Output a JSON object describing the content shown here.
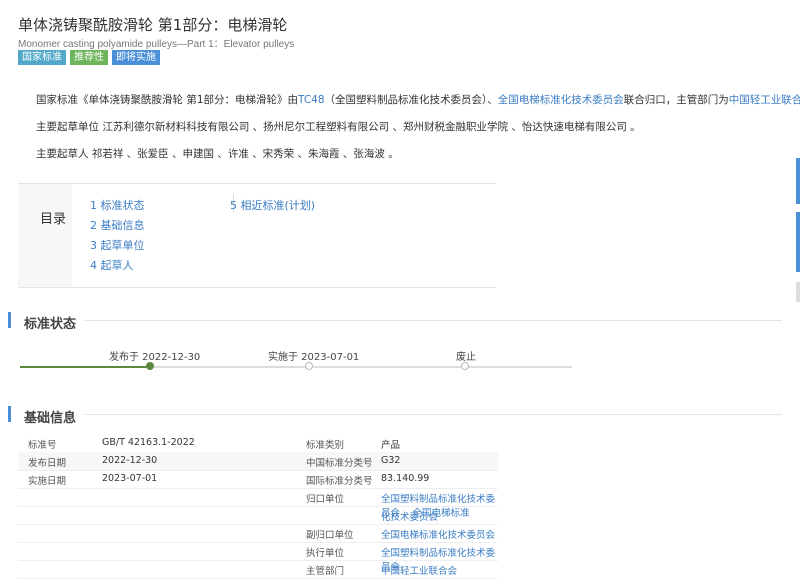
{
  "header": {
    "title": "单体浇铸聚酰胺滑轮 第1部分：电梯滑轮",
    "subtitle": "Monomer casting polyamide pulleys—Part 1：Elevator pulleys",
    "badges": [
      {
        "label": "国家标准",
        "color": "#52a8c8"
      },
      {
        "label": "推荐性",
        "color": "#6db45b"
      },
      {
        "label": "即将实施",
        "color": "#4a90d9"
      }
    ]
  },
  "intro": {
    "line1_a": "国家标准《单体浇铸聚酰胺滑轮 第1部分：电梯滑轮》由",
    "line1_tc": "TC48",
    "line1_b": "（全国塑料制品标准化技术委员会）、",
    "line1_c": "全国电梯标准化技术委员会",
    "line1_d": "联合归口，主管部门为",
    "line1_e": "中国轻工业联合会",
    "line1_f": "。",
    "line2": "主要起草单位 江苏利德尔新材料科技有限公司 、扬州尼尔工程塑料有限公司 、郑州财税金融职业学院 、怡达快速电梯有限公司 。",
    "line3": "主要起草人 祁若祥 、张爱臣 、申建国 、许准 、宋秀荣 、朱海霞 、张海波 。"
  },
  "toc": {
    "title": "目录",
    "items": [
      "1  标准状态",
      "2  基础信息",
      "3  起草单位",
      "4  起草人",
      "5  相近标准(计划)"
    ]
  },
  "status": {
    "heading": "标准状态",
    "steps": [
      {
        "label": "发布于 2022-12-30",
        "done": true
      },
      {
        "label": "实施于 2023-07-01",
        "done": false
      },
      {
        "label": "废止",
        "done": false
      }
    ]
  },
  "basic": {
    "heading": "基础信息",
    "rows": [
      {
        "k1": "标准号",
        "v1": "GB/T 42163.1-2022",
        "k2": "标准类别",
        "v2": "产品",
        "v2_link": false
      },
      {
        "k1": "发布日期",
        "v1": "2022-12-30",
        "k2": "中国标准分类号",
        "v2": "G32",
        "v2_link": false
      },
      {
        "k1": "实施日期",
        "v1": "2023-07-01",
        "k2": "国际标准分类号",
        "v2": "83.140.99",
        "v2_link": false
      },
      {
        "k1": "",
        "v1": "",
        "k2": "归口单位",
        "v2": "全国塑料制品标准化技术委员会 、全国电梯标准",
        "v2_link": true
      },
      {
        "k1": "",
        "v1": "",
        "k2": "",
        "v2": "化技术委员会",
        "v2_link": true
      },
      {
        "k1": "",
        "v1": "",
        "k2": "副归口单位",
        "v2": "全国电梯标准化技术委员会",
        "v2_link": true
      },
      {
        "k1": "",
        "v1": "",
        "k2": "执行单位",
        "v2": "全国塑料制品标准化技术委员会",
        "v2_link": true
      },
      {
        "k1": "",
        "v1": "",
        "k2": "主管部门",
        "v2": "中国轻工业联合会",
        "v2_link": true
      }
    ]
  }
}
